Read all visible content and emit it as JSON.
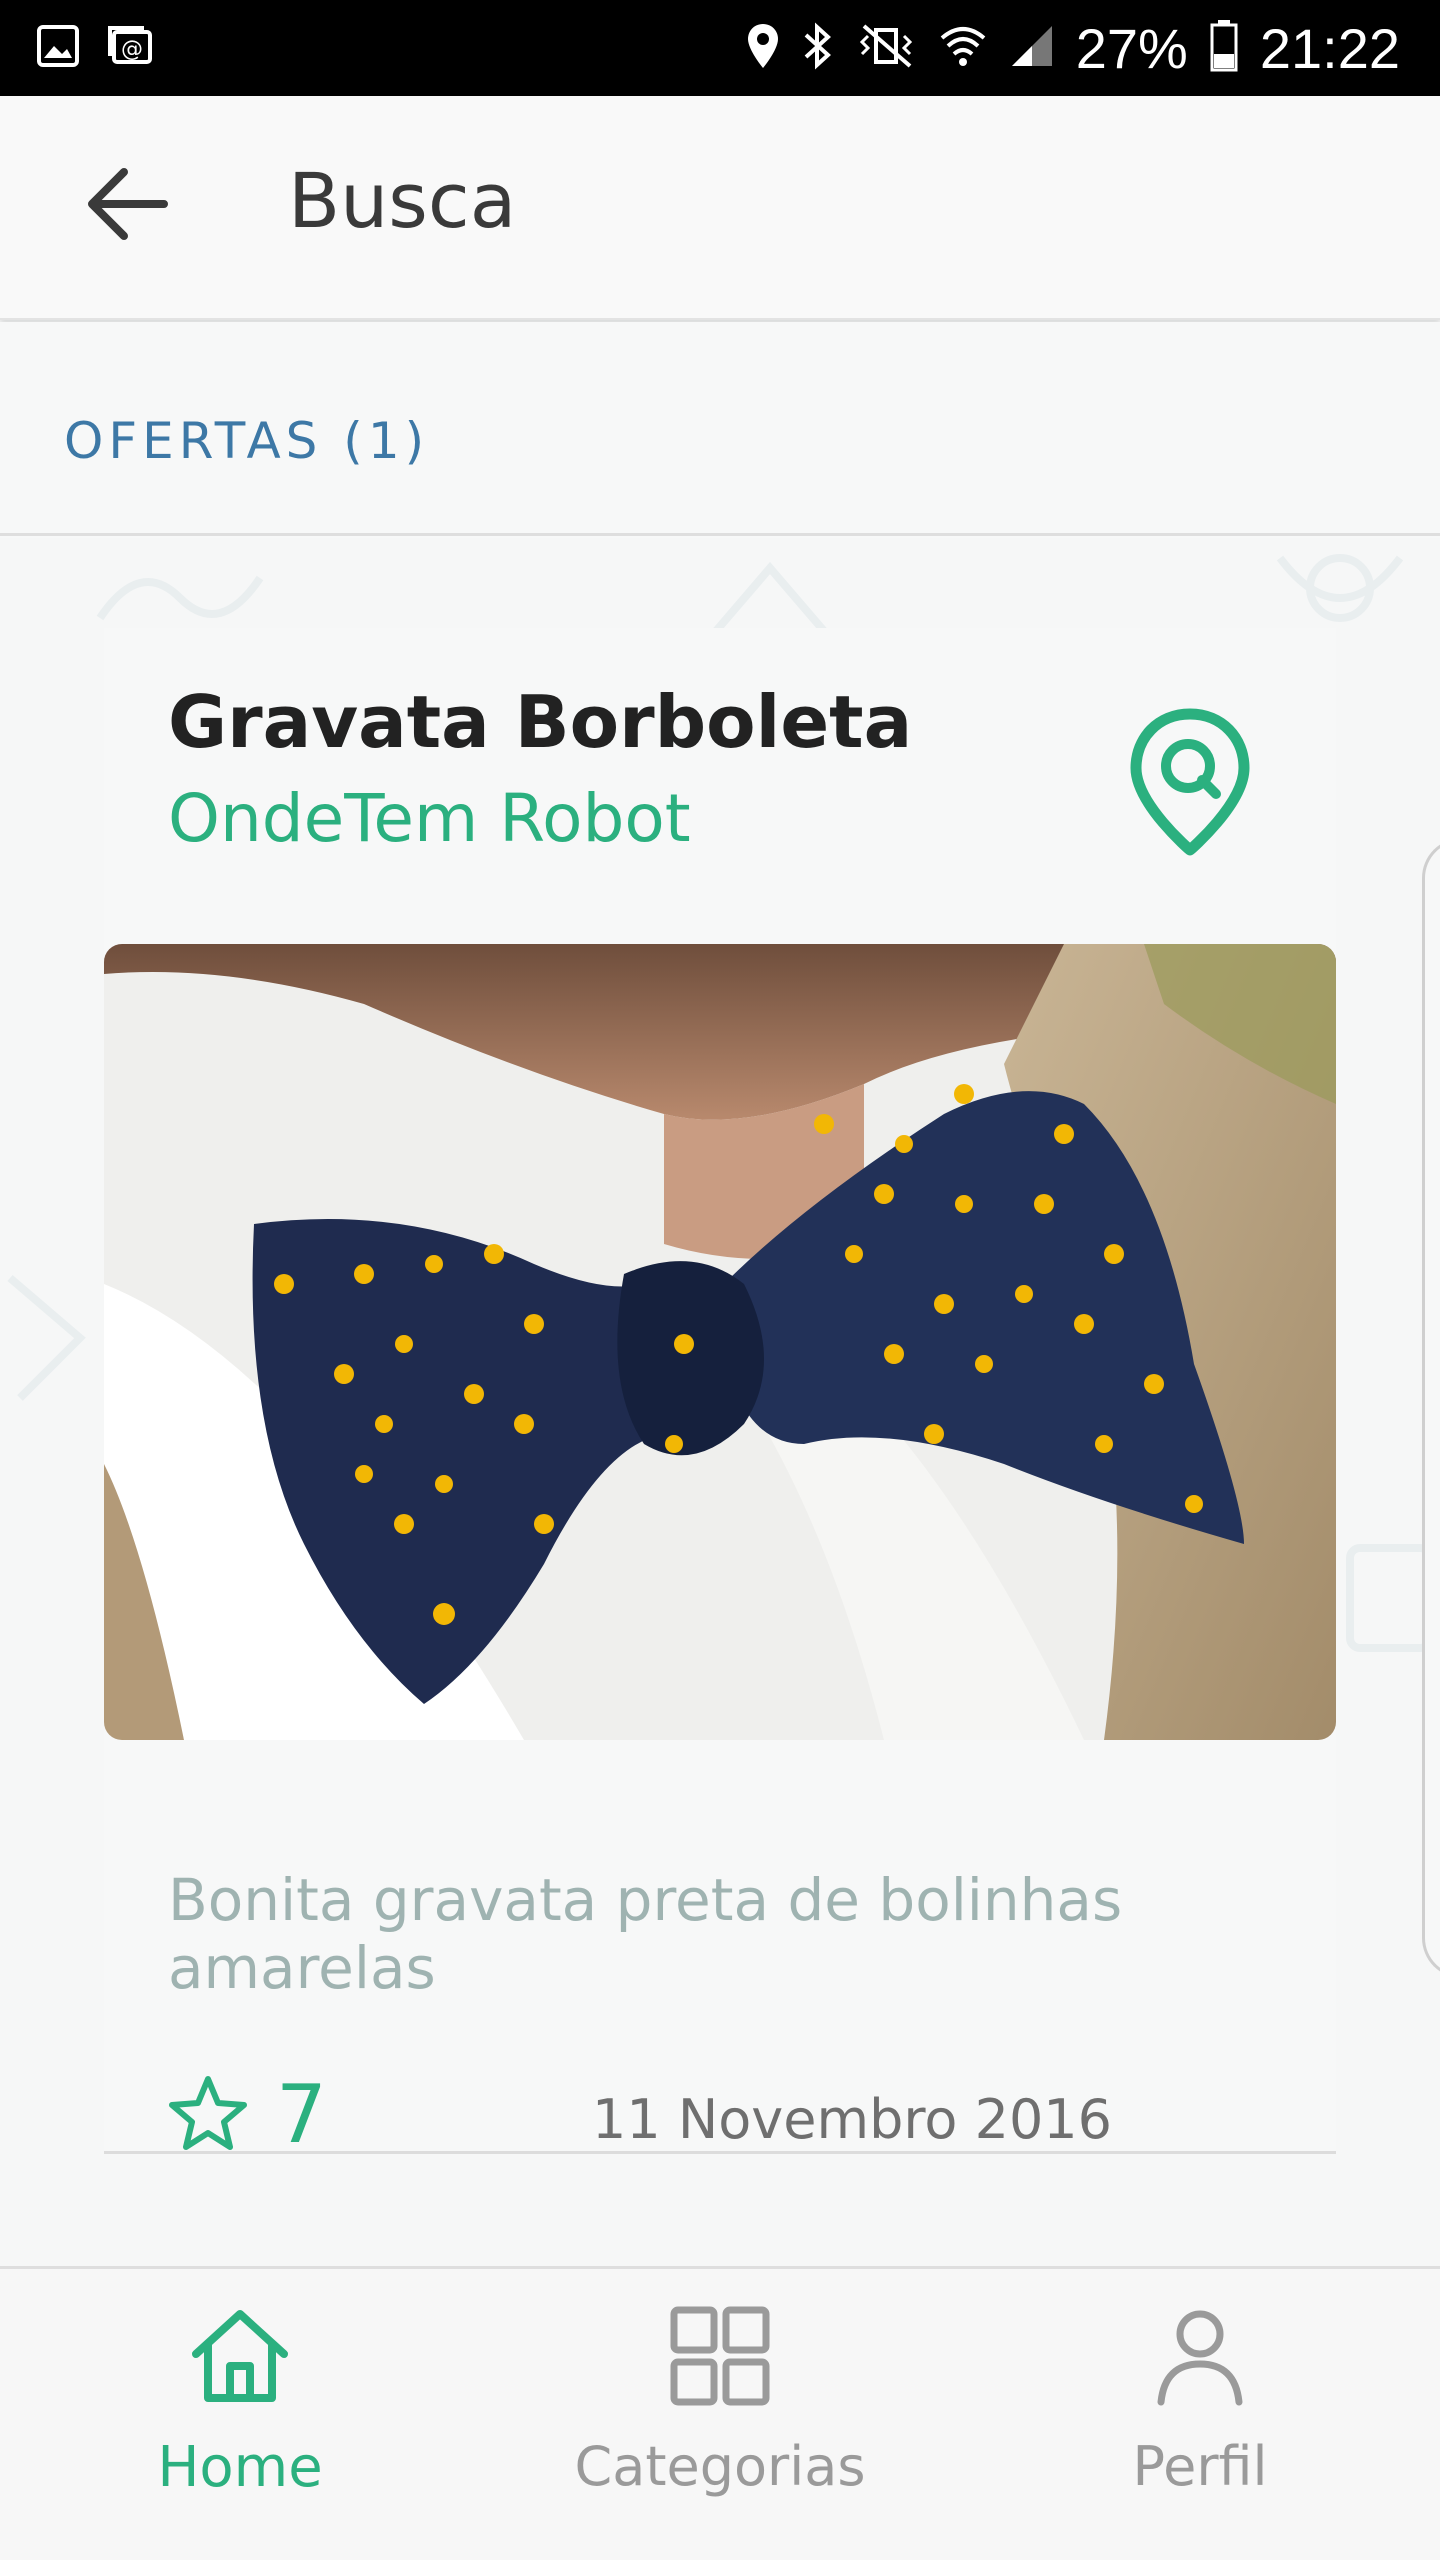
{
  "status_bar": {
    "battery": "27%",
    "time": "21:22",
    "icons": [
      "gallery-icon",
      "email-sync-icon",
      "location-icon",
      "bluetooth-icon",
      "mute-vibrate-icon",
      "wifi-icon",
      "signal-icon",
      "battery-icon"
    ]
  },
  "app_bar": {
    "title": "Busca",
    "back_icon": "arrow-left-icon"
  },
  "tabs": {
    "offers_label": "OFERTAS (1)"
  },
  "offer": {
    "title": "Gravata Borboleta",
    "store": "OndeTem Robot",
    "description": "Bonita gravata preta de bolinhas amarelas",
    "rating": "7",
    "date": "11 Novembro 2016",
    "map_icon": "map-pin-search-icon",
    "star_icon": "star-outline-icon"
  },
  "bottom_nav": {
    "items": [
      {
        "label": "Home",
        "icon": "home-icon",
        "active": true
      },
      {
        "label": "Categorias",
        "icon": "grid-icon",
        "active": false
      },
      {
        "label": "Perfil",
        "icon": "user-icon",
        "active": false
      }
    ]
  },
  "colors": {
    "accent": "#2bb07f",
    "tab_text": "#3d78a6",
    "status_bar": "#000000",
    "description": "#9fb3b1"
  }
}
